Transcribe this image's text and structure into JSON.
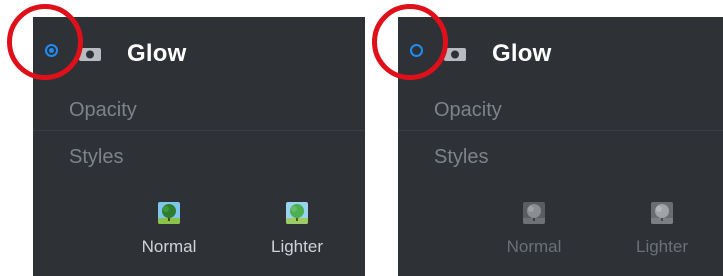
{
  "panels": [
    {
      "state": "enabled",
      "title": "Glow",
      "rows": {
        "opacity": "Opacity",
        "styles": "Styles"
      },
      "style_options": [
        {
          "label": "Normal",
          "icon": "tree-icon"
        },
        {
          "label": "Lighter",
          "icon": "tree-icon"
        }
      ]
    },
    {
      "state": "disabled",
      "title": "Glow",
      "rows": {
        "opacity": "Opacity",
        "styles": "Styles"
      },
      "style_options": [
        {
          "label": "Normal",
          "icon": "tree-icon"
        },
        {
          "label": "Lighter",
          "icon": "tree-icon"
        }
      ]
    }
  ],
  "colors": {
    "panel_bg": "#2e3136",
    "accent": "#1e8cf0",
    "highlight_circle": "#e0101a",
    "muted_text": "#7d838b"
  }
}
